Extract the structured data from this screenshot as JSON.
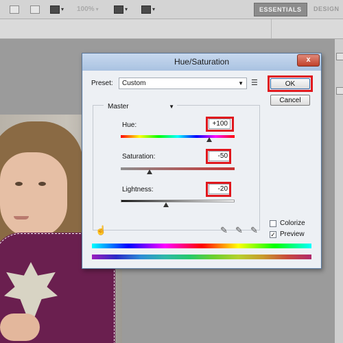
{
  "app": {
    "toolbar": {
      "zoom_text": "100%",
      "workspaces": [
        "ESSENTIALS",
        "DESIGN"
      ]
    }
  },
  "dialog": {
    "title": "Hue/Saturation",
    "close_label": "x",
    "preset": {
      "label": "Preset:",
      "value": "Custom"
    },
    "channel": {
      "value": "Master"
    },
    "buttons": {
      "ok": "OK",
      "cancel": "Cancel"
    },
    "hue": {
      "label": "Hue:",
      "value": "+100",
      "level": 100,
      "min": -180,
      "max": 180
    },
    "saturation": {
      "label": "Saturation:",
      "value": "-50",
      "level": -50,
      "min": -100,
      "max": 100
    },
    "lightness": {
      "label": "Lightness:",
      "value": "-20",
      "level": -20,
      "min": -100,
      "max": 100
    },
    "colorize": {
      "label": "Colorize",
      "checked": false
    },
    "preview": {
      "label": "Preview",
      "checked": true
    },
    "highlight_color": "#e0171d"
  }
}
